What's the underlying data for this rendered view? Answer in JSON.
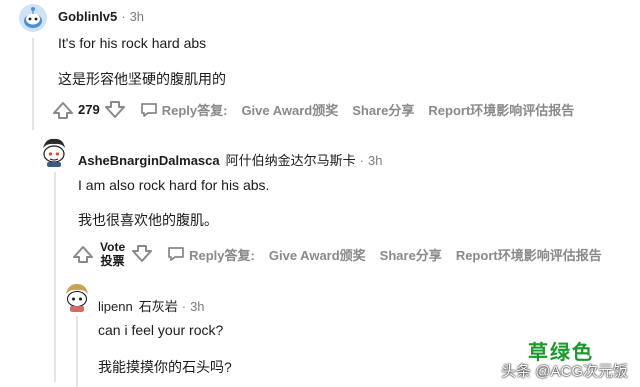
{
  "comments": [
    {
      "username": "Goblinlv5",
      "cn_name": "",
      "separator": "·",
      "time": "3h",
      "text_en": "It's for his rock hard abs",
      "text_cn": "这是形容他坚硬的腹肌用的",
      "score": "279"
    },
    {
      "username": "AsheBnarginDalmasca",
      "cn_name": "阿什伯纳金达尔马斯卡",
      "separator": "·",
      "time": "3h",
      "text_en": "I am also rock hard for his abs.",
      "text_cn": "我也很喜欢他的腹肌。",
      "vote_label_en": "Vote",
      "vote_label_cn": "投票"
    },
    {
      "username": "lipenn",
      "cn_name": "石灰岩",
      "separator": "·",
      "time": "3h",
      "text_en": "can i feel your rock?",
      "text_cn": "我能摸摸你的石头吗?"
    }
  ],
  "actions": {
    "reply": "Reply答复:",
    "award": "Give Award颁奖",
    "share": "Share分享",
    "report": "Report环境影响评估报告"
  },
  "watermark": {
    "colored": "草绿色",
    "text": "头条 @ACG次元饭"
  },
  "colors": {
    "meta_gray": "#7c7c7c",
    "action_gray": "#878a8c",
    "thread_line": "#e1e3e4",
    "watermark_green": "#1a9a2a"
  }
}
